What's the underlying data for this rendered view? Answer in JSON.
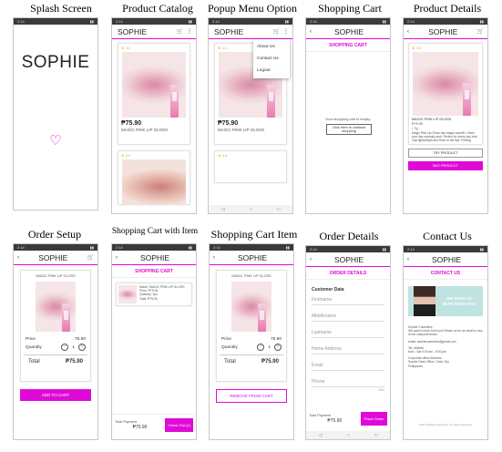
{
  "captions": [
    "Splash Screen",
    "Product Catalog",
    "Popup Menu Option",
    "Shopping Cart",
    "Product Details",
    "Order Setup",
    "Shopping Cart with Item",
    "Shopping Cart Item",
    "Order Details",
    "Contact Us"
  ],
  "brand": "SOPHIE",
  "status": {
    "time": "2:14",
    "battery": "▮▮"
  },
  "product": {
    "rating": "4.5",
    "price": "₱75.90",
    "name": "MAGIC PINK LIP GLOSS",
    "name_title": "MAGIC PINK LIP GLOSS"
  },
  "menu": [
    "About Us",
    "Contact Us",
    "Logout"
  ],
  "cart": {
    "title": "SHOPPING CART",
    "empty_text": "Your shopping cart is empty.",
    "continue_button": "Click here to continue shopping",
    "item_lines": [
      "Name: MAGIC PINK LIP GLOSS",
      "Price: ₱75.90",
      "Quantity: 1pc",
      "Total: ₱75.90"
    ],
    "total_label": "Total Payment",
    "total_value": "₱75.90",
    "checkout_button": "Check Out (1)"
  },
  "details": {
    "size": "• 7g",
    "description": "Magic Pink Lip Gloss has magic warmth. Gives your lips naturally pink. Perfect for every day look. Just lightweight and fresh to the lips. Feeling",
    "try_button": "TRY PRODUCT",
    "buy_button": "BUY PRODUCT"
  },
  "order_setup": {
    "price_label": "Price",
    "price_value": "75.90",
    "qty_label": "Quantity",
    "qty_value": "1",
    "total_label": "Total",
    "total_value": "₱75.90",
    "add_button": "ADD TO CART",
    "remove_button": "REMOVE FROM CART"
  },
  "order_details": {
    "title": "ORDER DETAILS",
    "section": "Customer Data",
    "fields": [
      "Firstname",
      "Middlename",
      "Lastname",
      "Home Address",
      "Email",
      "Phone"
    ],
    "counter": "0/11",
    "total_label": "Total Payment",
    "total_value": "₱75.90",
    "place_button": "Place Order"
  },
  "contact": {
    "title": "CONTACT US",
    "banner_line1": "WE WANT TO",
    "banner_line2": "HEAR FROM YOU!",
    "lines": [
      "Sophie Cosmetics",
      "We want to hear from you! Reach us for an email or any of the channels below",
      "email: sophiecosmetics@gmail.com",
      "Tel: ######",
      "Mon - Sat 9:00 am - 5:00 pm",
      "Corporate office Address:",
      "Sophie Head Office, Cebu City",
      "Philippines"
    ],
    "footer": "2017 Sophie Cosmetics. All rights reserved"
  },
  "icons": {
    "back": "back-arrow-icon",
    "cart": "cart-icon",
    "menu": "more-vert-icon",
    "heart": "heart-icon"
  },
  "colors": {
    "accent": "#e00ad8",
    "status": "#3a3a3a"
  }
}
